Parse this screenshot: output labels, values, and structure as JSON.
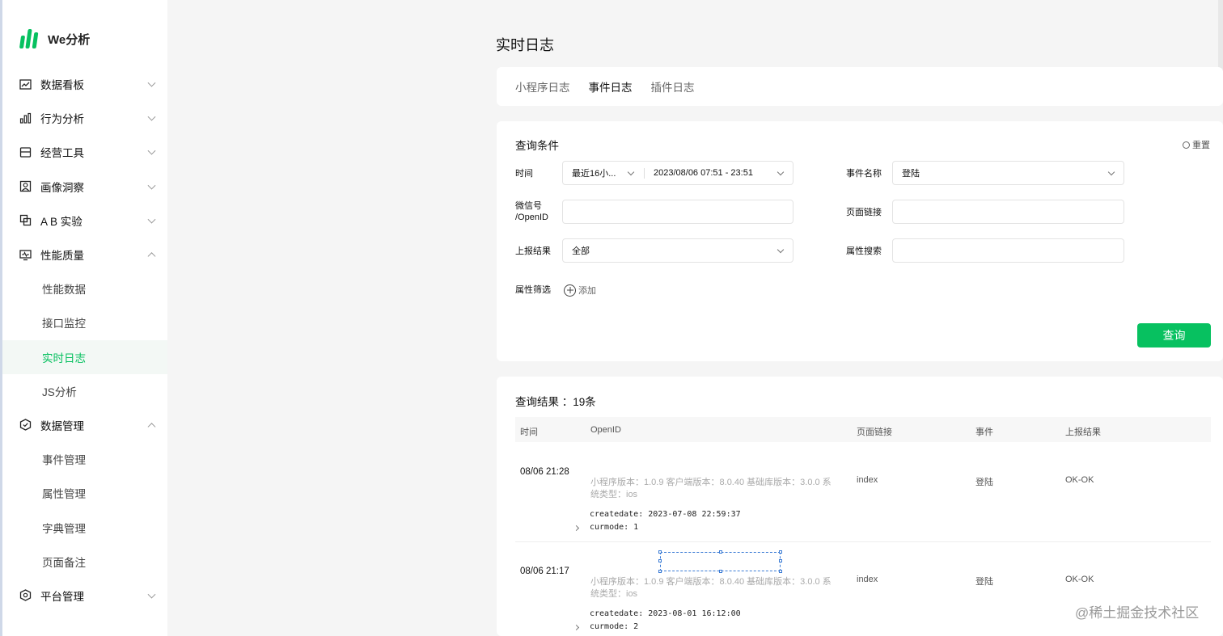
{
  "brand": {
    "name": "We分析"
  },
  "sidebar": {
    "items": [
      {
        "label": "数据看板",
        "icon": "chart-line-icon"
      },
      {
        "label": "行为分析",
        "icon": "bar-chart-icon"
      },
      {
        "label": "经营工具",
        "icon": "store-icon"
      },
      {
        "label": "画像洞察",
        "icon": "user-portrait-icon"
      },
      {
        "label": "A B 实验",
        "icon": "ab-test-icon"
      },
      {
        "label": "性能质量",
        "icon": "monitor-pulse-icon"
      },
      {
        "label": "性能数据"
      },
      {
        "label": "接口监控"
      },
      {
        "label": "实时日志"
      },
      {
        "label": "JS分析"
      },
      {
        "label": "数据管理",
        "icon": "check-shield-icon"
      },
      {
        "label": "事件管理"
      },
      {
        "label": "属性管理"
      },
      {
        "label": "字典管理"
      },
      {
        "label": "页面备注"
      },
      {
        "label": "平台管理",
        "icon": "settings-icon"
      }
    ],
    "accent": "#07c160"
  },
  "page": {
    "title": "实时日志"
  },
  "tabs": [
    {
      "label": "小程序日志"
    },
    {
      "label": "事件日志"
    },
    {
      "label": "插件日志"
    }
  ],
  "query": {
    "title": "查询条件",
    "reset": "重置",
    "time_label": "时间",
    "time_range_preset": "最近16小...",
    "time_range": "2023/08/06 07:51 - 23:51",
    "event_label": "事件名称",
    "event_value": "登陆",
    "openid_label_line1": "微信号",
    "openid_label_line2": "/OpenID",
    "openid_value": "",
    "page_link_label": "页面链接",
    "page_link_value": "",
    "report_label": "上报结果",
    "report_value": "全部",
    "attr_search_label": "属性搜索",
    "attr_search_value": "",
    "attr_filter_label": "属性筛选",
    "add_label": "添加",
    "submit": "查询"
  },
  "result": {
    "title": "查询结果 ：19条",
    "columns": [
      "时间",
      "OpenID",
      "页面链接",
      "事件",
      "上报结果"
    ],
    "rows": [
      {
        "time": "08/06 21:28",
        "meta": "小程序版本：1.0.9 客户端版本：8.0.40 基础库版本：3.0.0 系统类型：ios",
        "createdate": "createdate: 2023-07-08 22:59:37",
        "curmode": "curmode: 1",
        "page": "index",
        "event": "登陆",
        "result": "OK-OK"
      },
      {
        "time": "08/06 21:17",
        "meta": "小程序版本：1.0.9 客户端版本：8.0.40 基础库版本：3.0.0 系统类型：ios",
        "createdate": "createdate: 2023-08-01 16:12:00",
        "curmode": "curmode: 2",
        "page": "index",
        "event": "登陆",
        "result": "OK-OK"
      }
    ]
  },
  "watermark": "@稀土掘金技术社区"
}
